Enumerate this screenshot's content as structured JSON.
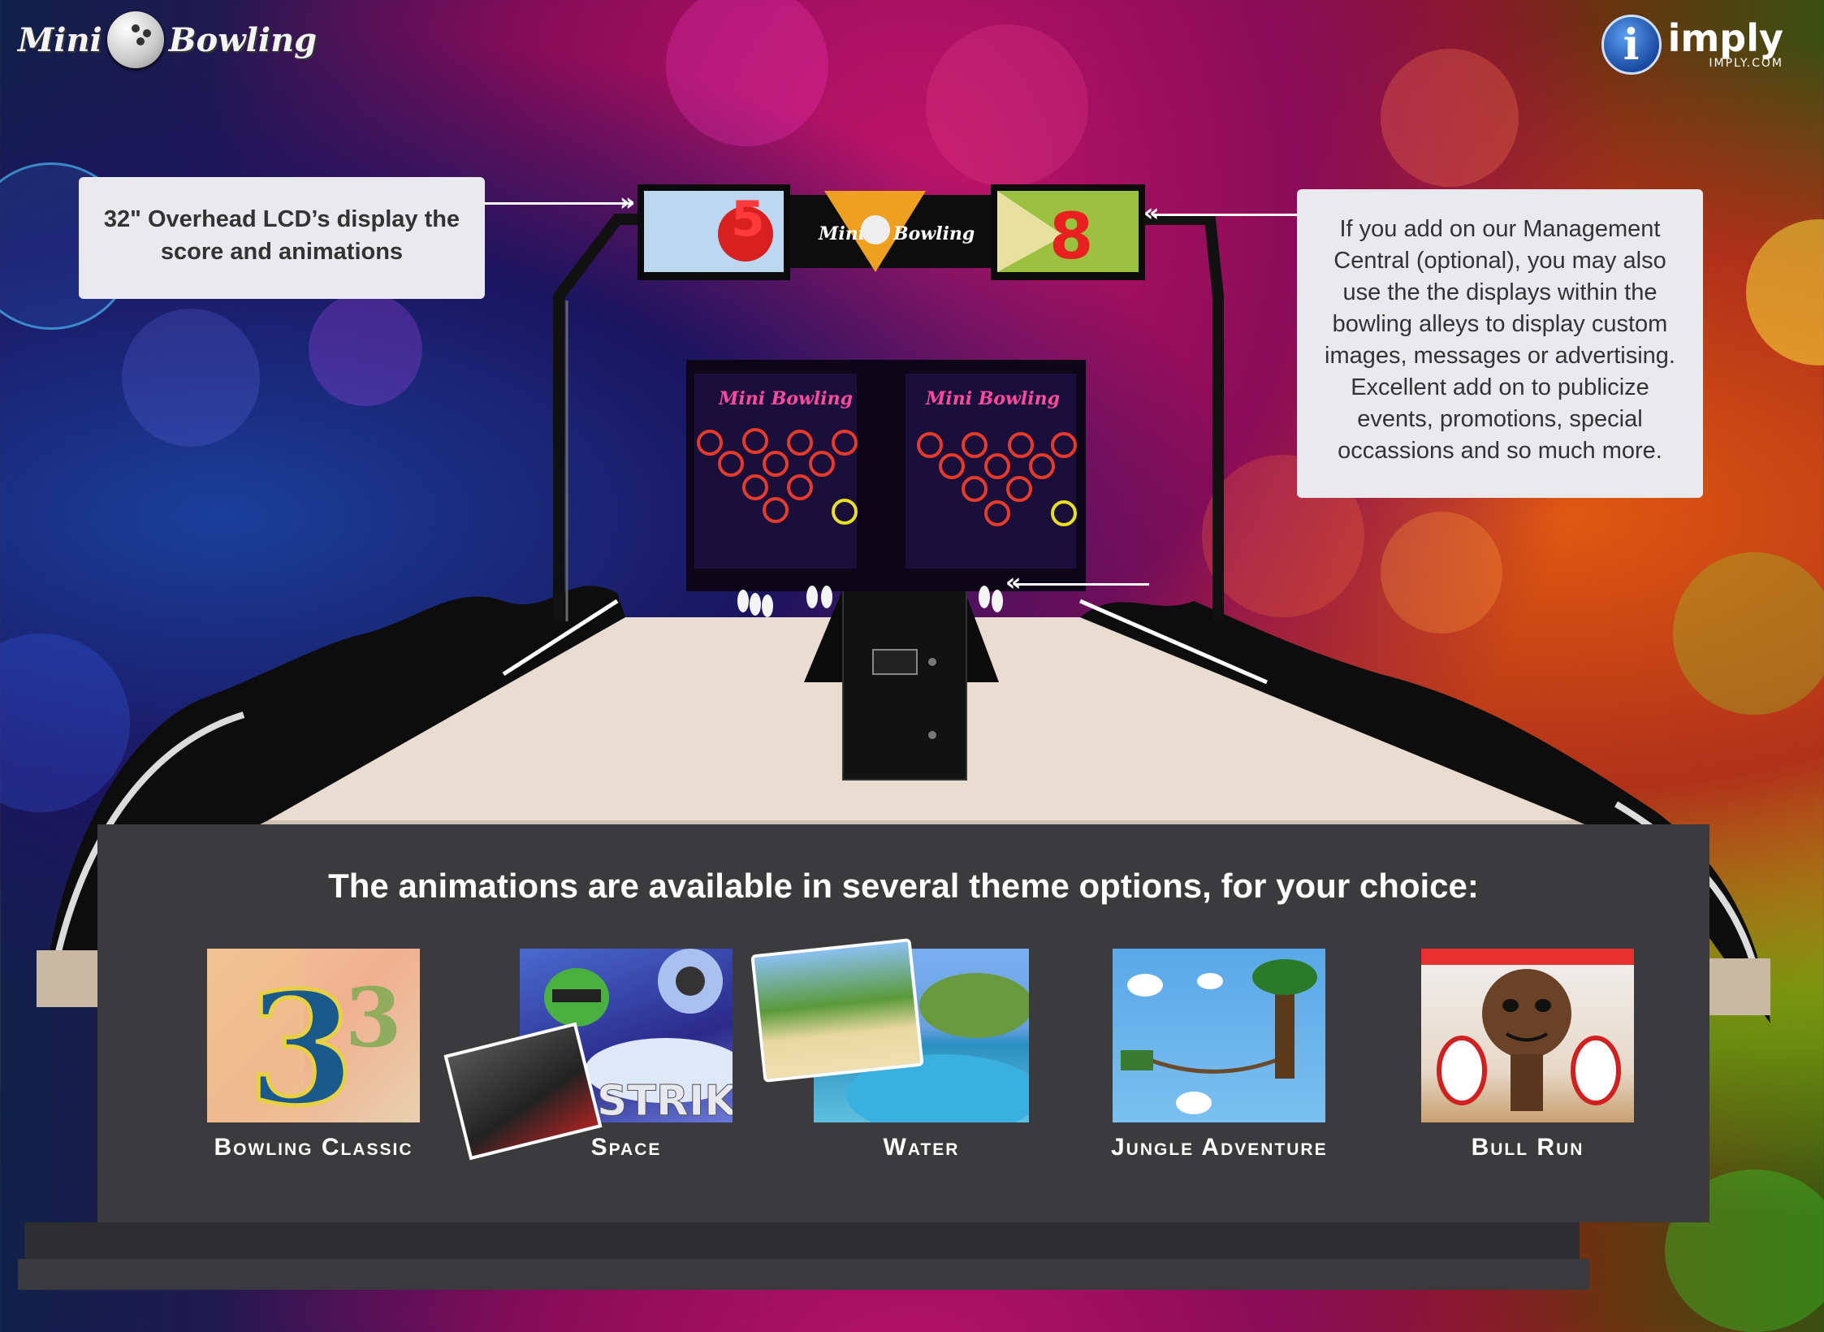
{
  "header": {
    "left_logo": {
      "word1": "Mini",
      "word2": "Bowling"
    },
    "right_logo": {
      "letter": "i",
      "brand": "imply",
      "url": "IMPLY.COM"
    }
  },
  "callouts": {
    "left": "32\" Overhead LCD’s display the score and animations",
    "right": "If you add on our Management Central (optional), you may also use the the displays within the bowling alleys to display custom images, messages or advertising. Excellent add on to publicize events, promotions, special occassions and so much more."
  },
  "screens": {
    "left_digit": "5",
    "right_digit": "8",
    "sign_word1": "Mini",
    "sign_word2": "Bowling",
    "lane_screen_logo": "Mini Bowling"
  },
  "themes_panel": {
    "title": "The animations are available in several theme options, for your choice:",
    "themes": [
      {
        "label": "Bowling Classic"
      },
      {
        "label": "Space"
      },
      {
        "label": "Water"
      },
      {
        "label": "Jungle Adventure"
      },
      {
        "label": "Bull Run"
      }
    ]
  }
}
